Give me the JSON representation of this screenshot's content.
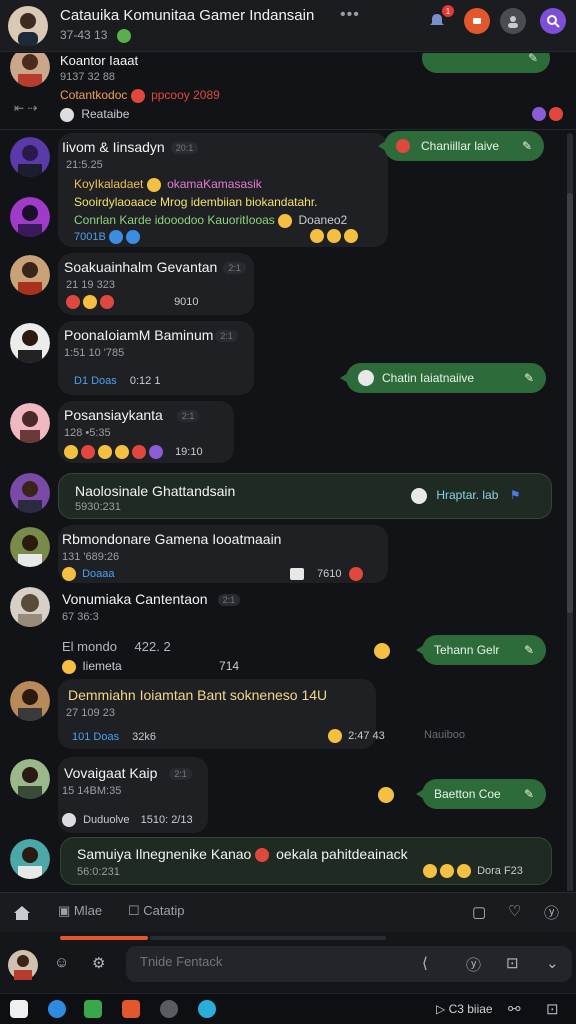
{
  "header": {
    "title": "Catauika Komunitaa Gamer Indansain",
    "subtitle": "37-43 13",
    "more": "•••",
    "badge_count": "1"
  },
  "messages": [
    {
      "id": "m0",
      "name": "Koantor Iaaat",
      "time": "9137 32 88",
      "text": "Cotantkodoc",
      "extra": "ppcooy 2089",
      "reply": "Reataibe"
    },
    {
      "id": "m1",
      "name": "Iivom & Iinsadyn",
      "pill": "20:1",
      "time": "21:5.25",
      "line1": "KoyIkaladaet",
      "line1b": "okamaKamasasik",
      "line2": "Sooirdylaoaace Mrog idembiian biokandatahr.",
      "line3": "Conrlan Karde idooodoo KauoritIooas",
      "line3b": "Doaneo2",
      "meta": "7001B"
    },
    {
      "id": "m2",
      "name": "Soakuainhalm Gevantan",
      "pill": "2:1",
      "time": "21 19 323",
      "meta": "9010"
    },
    {
      "id": "m3",
      "name": "PoonaIoiamM Baminum",
      "pill": "2:1",
      "time": "1:51 10 '785",
      "meta1": "D1 Doas",
      "meta2": "0:12 1"
    },
    {
      "id": "m4",
      "name": "Posansiaykanta",
      "pill": "2:1",
      "time": "128 •5:35",
      "meta": "19:10"
    },
    {
      "id": "m5",
      "name": "Naolosinale Ghattandsain",
      "time": "5930:231",
      "reply": "Hraptar. lab"
    },
    {
      "id": "m6",
      "name": "Rbmondonare Gamena Iooatmaain",
      "time": "131 '689:26",
      "meta1": "Doaaa",
      "meta2": "7610"
    },
    {
      "id": "m7",
      "name": "Vonumiaka Cantentaon",
      "pill": "2:1",
      "time": "67 36:3",
      "note1": "El mondo",
      "note1b": "422. 2",
      "note2": "Iiemeta",
      "note2b": "714"
    },
    {
      "id": "m8",
      "name": "Demmiahn Ioiamtan Bant sokneneso 14U",
      "time": "27 109 23",
      "meta1": "101 Doas",
      "meta2": "32k6",
      "meta3": "2:47 43",
      "meta4": "Nauiboo"
    },
    {
      "id": "m9",
      "name": "Vovaigaat Kaip",
      "pill": "2:1",
      "time": "15 14BM:35",
      "meta1": "Duduolve",
      "meta2": "1510: 2/13"
    },
    {
      "id": "m10",
      "name": "Samuiya Ilnegnenike Kanao",
      "extra": "oekala pahitdeainack",
      "time": "56:0:231",
      "meta": "Dora F23"
    }
  ],
  "actions": {
    "a1": "Chaniillar laive",
    "a2": "Chatin Iaiatnaiive",
    "a3": "Tehann Gelr",
    "a4": "Baetton Coe"
  },
  "toolbar": {
    "item1": "Mlae",
    "item2": "Catatip"
  },
  "composer": {
    "placeholder": "Tnide Fentack"
  },
  "taskbar": {
    "right_label": "C3 biiae"
  }
}
